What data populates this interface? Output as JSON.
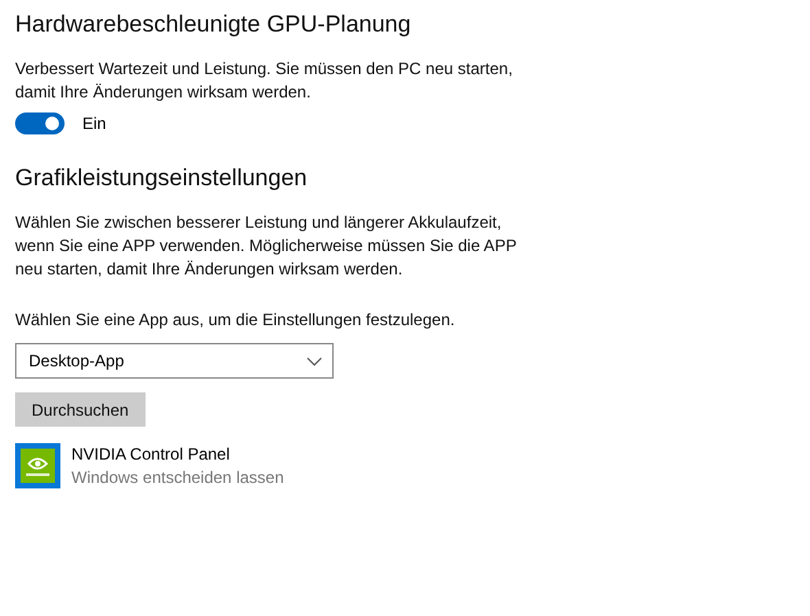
{
  "sections": [
    {
      "title": "Hardwarebeschleunigte GPU-Planung",
      "paragraphs": [
        "Verbessert Wartezeit und Leistung. Sie müssen den PC neu starten, damit Ihre Änderungen wirksam werden."
      ],
      "toggle": {
        "on": true,
        "label": "Ein"
      }
    },
    {
      "title": "Grafikleistungseinstellungen",
      "paragraphs": [
        "Wählen Sie zwischen besserer Leistung und längerer Akkulaufzeit, wenn Sie eine APP verwenden. Möglicherweise müssen Sie die APP neu starten, damit Ihre Änderungen wirksam werden.",
        "Wählen Sie eine App aus, um die Einstellungen festzulegen."
      ],
      "dropdown": {
        "value": "Desktop-App"
      },
      "button": "Durchsuchen",
      "apps": [
        {
          "name": "NVIDIA Control Panel",
          "setting": "Windows entscheiden lassen"
        }
      ]
    }
  ]
}
